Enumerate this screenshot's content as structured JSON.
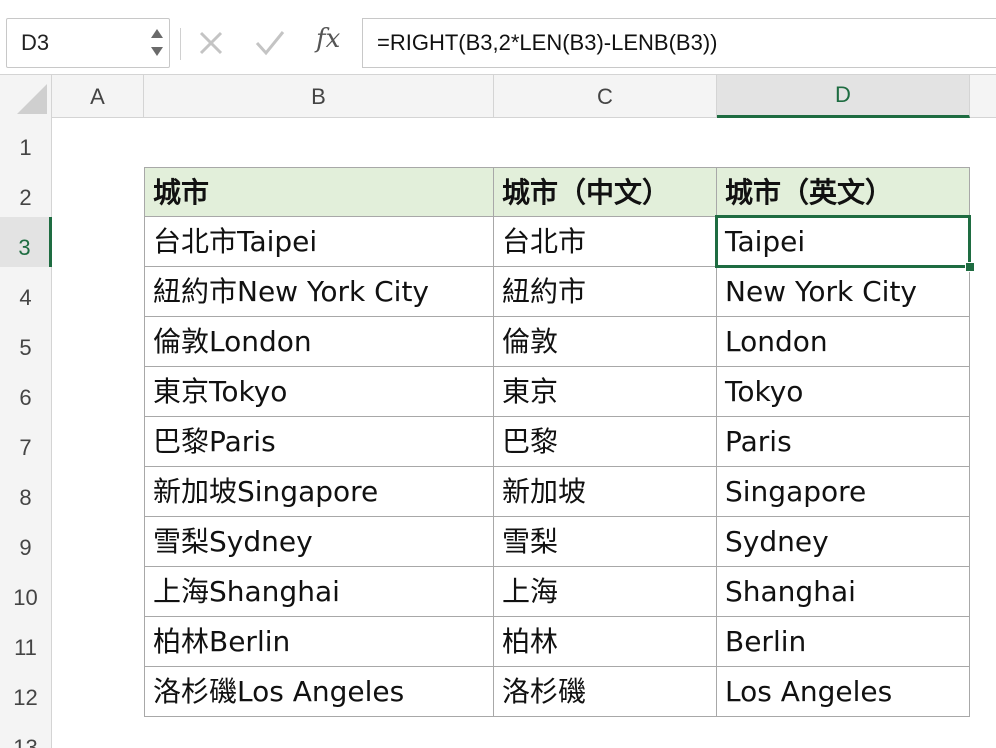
{
  "name_box": {
    "value": "D3"
  },
  "formula_bar": {
    "fx_label": "fx",
    "formula": "=RIGHT(B3,2*LEN(B3)-LENB(B3))"
  },
  "columns": [
    "A",
    "B",
    "C",
    "D"
  ],
  "active_column": "D",
  "rows": [
    "1",
    "2",
    "3",
    "4",
    "5",
    "6",
    "7",
    "8",
    "9",
    "10",
    "11",
    "12",
    "13"
  ],
  "active_row": "3",
  "table": {
    "headers": [
      "城市",
      "城市（中文）",
      "城市（英文）"
    ],
    "rows": [
      [
        "台北市Taipei",
        "台北市",
        "Taipei"
      ],
      [
        "紐約市New York City",
        "紐約市",
        "New York City"
      ],
      [
        "倫敦London",
        "倫敦",
        "London"
      ],
      [
        "東京Tokyo",
        "東京",
        "Tokyo"
      ],
      [
        "巴黎Paris",
        "巴黎",
        "Paris"
      ],
      [
        "新加坡Singapore",
        "新加坡",
        "Singapore"
      ],
      [
        "雪梨Sydney",
        "雪梨",
        "Sydney"
      ],
      [
        "上海Shanghai",
        "上海",
        "Shanghai"
      ],
      [
        "柏林Berlin",
        "柏林",
        "Berlin"
      ],
      [
        "洛杉磯Los Angeles",
        "洛杉磯",
        "Los Angeles"
      ]
    ]
  },
  "colors": {
    "accent": "#1e6c41",
    "header_fill": "#e2efda",
    "grid_line": "#a8a8a8"
  }
}
